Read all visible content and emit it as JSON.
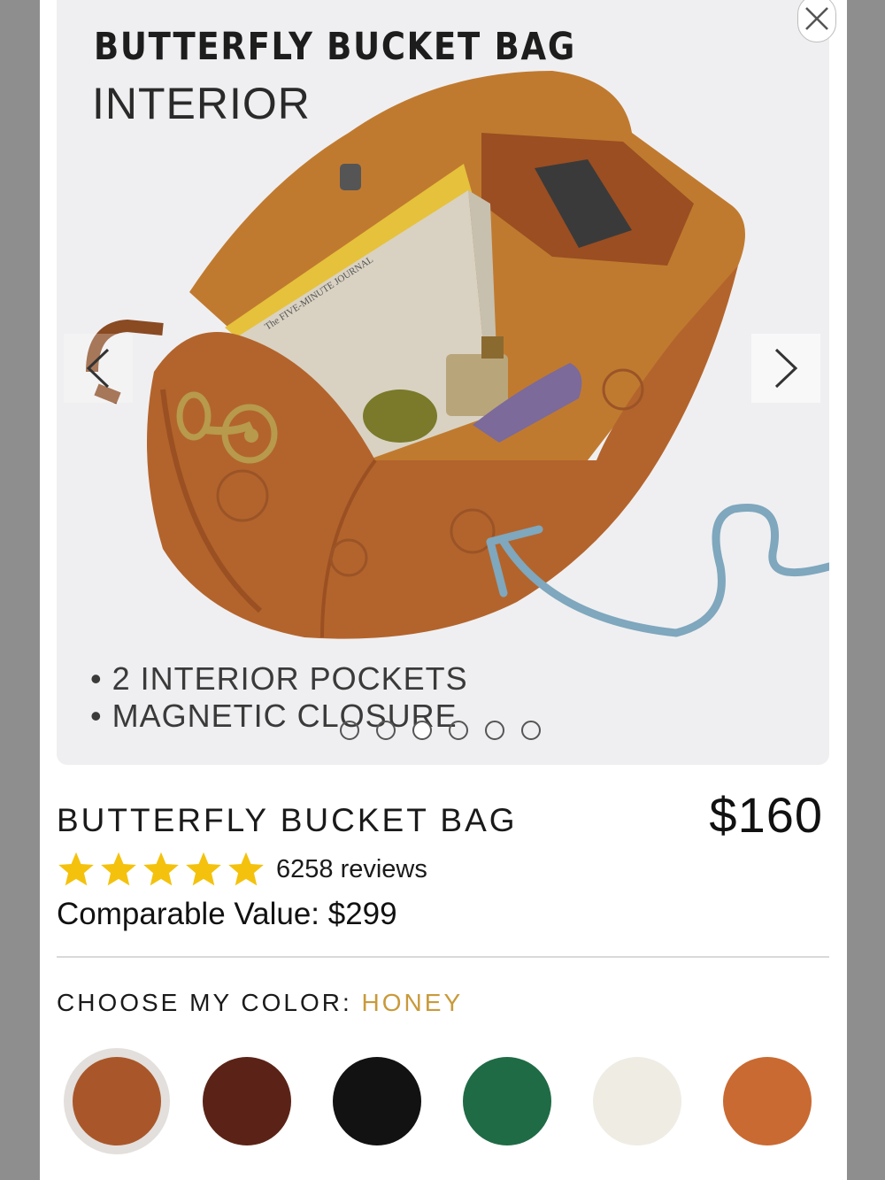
{
  "gallery": {
    "title": "BUTTERFLY BUCKET BAG",
    "subtitle": "INTERIOR",
    "features": [
      "2 INTERIOR POCKETS",
      "MAGNETIC CLOSURE"
    ],
    "book_text": "The FIVE-MINUTE JOURNAL",
    "slide_count": 6,
    "active_slide": 3
  },
  "product": {
    "name": "BUTTERFLY BUCKET BAG",
    "price": "$160",
    "rating": 5,
    "reviews": "6258 reviews",
    "comparable": "Comparable Value: $299"
  },
  "color_picker": {
    "label": "CHOOSE MY COLOR:",
    "selected": "HONEY",
    "swatches": [
      "#a9572a",
      "#5b2317",
      "#121212",
      "#1f6b45",
      "#efece4",
      "#c96a32"
    ]
  },
  "colors": {
    "star": "#f4c20d",
    "accent": "#c99a3b",
    "arrow": "#7fa7bd"
  },
  "icons": {
    "close": "close-icon",
    "prev": "chevron-left-icon",
    "next": "chevron-right-icon",
    "star": "star-icon"
  }
}
